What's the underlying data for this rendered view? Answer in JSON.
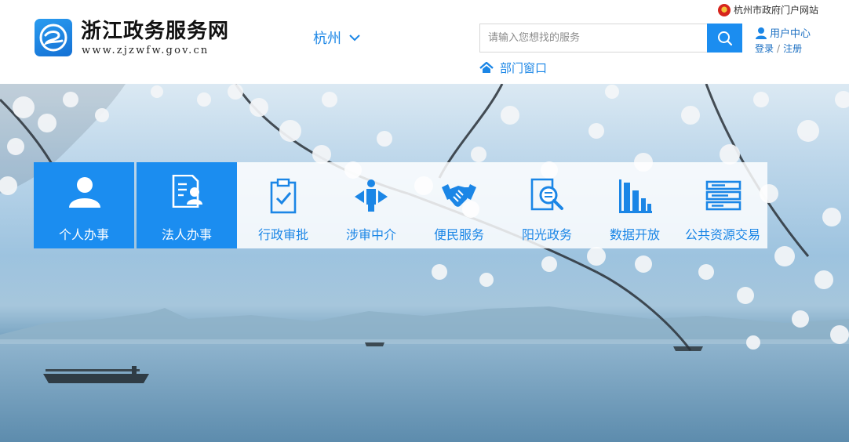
{
  "header": {
    "site_title": "浙江政务服务网",
    "site_url": "www.zjzwfw.gov.cn",
    "city": "杭州",
    "search": {
      "placeholder": "请输入您想找的服务",
      "value": ""
    },
    "department_window": "部门窗口",
    "gov_portal_link": "杭州市政府门户网站",
    "user_center": "用户中心",
    "login": "登录",
    "separator": "/",
    "register": "注册"
  },
  "nav": {
    "personal": "个人办事",
    "legal": "法人办事",
    "items": [
      {
        "label": "行政审批",
        "icon": "clipboard-check-icon"
      },
      {
        "label": "涉审中介",
        "icon": "intermediary-icon"
      },
      {
        "label": "便民服务",
        "icon": "handshake-icon"
      },
      {
        "label": "阳光政务",
        "icon": "document-search-icon"
      },
      {
        "label": "数据开放",
        "icon": "bar-chart-icon"
      },
      {
        "label": "公共资源交易",
        "icon": "server-list-icon"
      }
    ]
  },
  "colors": {
    "accent": "#1b8df0",
    "link": "#1b86e6",
    "tile": "#1b8df0"
  }
}
